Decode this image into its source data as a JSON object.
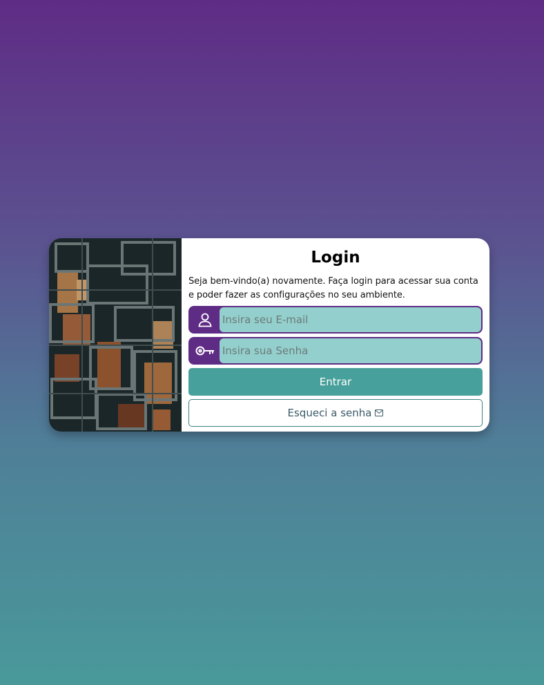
{
  "login": {
    "title": "Login",
    "description": "Seja bem-vindo(a) novamente. Faça login para acessar sua conta e poder fazer as configurações no seu ambiente.",
    "email": {
      "placeholder": "Insira seu E-mail",
      "icon": "user-icon"
    },
    "password": {
      "placeholder": "Insira sua Senha",
      "icon": "key-icon"
    },
    "submit_label": "Entrar",
    "forgot_label": "Esqueci a senha",
    "forgot_icon": "envelope-icon"
  },
  "colors": {
    "brand_purple": "#5f2c85",
    "teal": "#47a09b",
    "input_bg": "#93cfcc"
  }
}
